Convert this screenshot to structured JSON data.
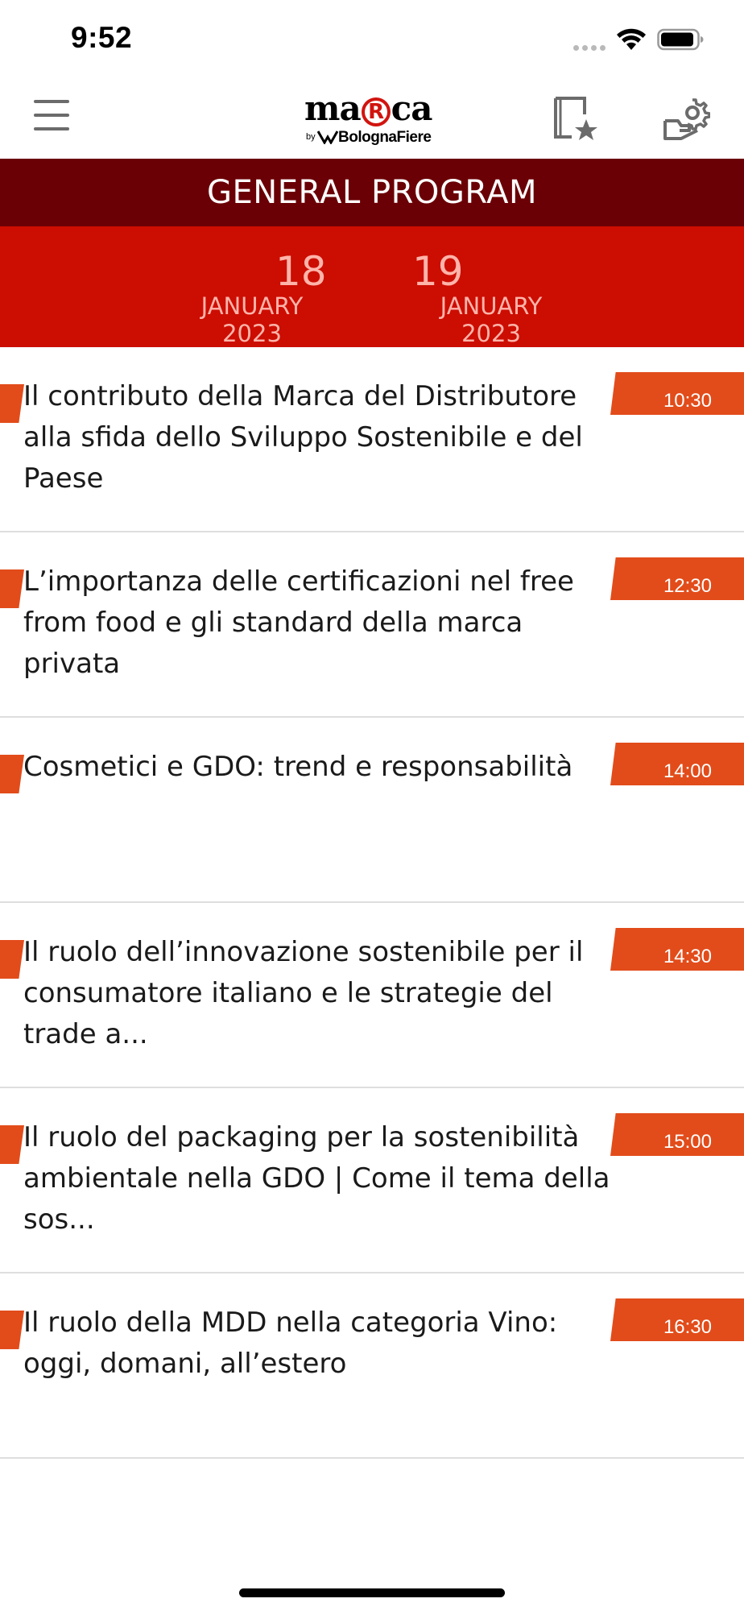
{
  "status_bar": {
    "time": "9:52",
    "wifi_icon": "wifi-icon",
    "battery_icon": "battery-icon"
  },
  "header": {
    "logo_text_left": "ma",
    "logo_text_circle": "R",
    "logo_text_right": "ca",
    "logo_by": "by",
    "logo_sub": "BolognaFiere",
    "menu_icon": "hamburger-menu-icon",
    "favorites_icon": "favorites-bookmark-icon",
    "settings_icon": "user-settings-icon"
  },
  "program": {
    "title": "GENERAL PROGRAM"
  },
  "dates": [
    {
      "day": "18",
      "month": "JANUARY 2023"
    },
    {
      "day": "19",
      "month": "JANUARY 2023"
    }
  ],
  "events": [
    {
      "title": "Il contributo della Marca del Distributore alla sfida dello Sviluppo Sostenibile e del Paese",
      "time": "10:30"
    },
    {
      "title": "L’importanza delle certificazioni nel free from food e gli standard della marca privata",
      "time": "12:30"
    },
    {
      "title": "Cosmetici e GDO: trend e responsabilità",
      "time": "14:00"
    },
    {
      "title": "Il ruolo dell’innovazione sostenibile per il consumatore italiano e le strategie del trade a...",
      "time": "14:30"
    },
    {
      "title": "Il ruolo del packaging per la sostenibilità ambientale nella GDO | Come il tema della sos...",
      "time": "15:00"
    },
    {
      "title": "Il ruolo della MDD nella categoria Vino: oggi, domani, all’estero",
      "time": "16:30"
    }
  ],
  "colors": {
    "program_bar": "#6a0006",
    "date_bar": "#cc0d02",
    "date_text": "#ffb4aa",
    "accent": "#e24c1a"
  }
}
